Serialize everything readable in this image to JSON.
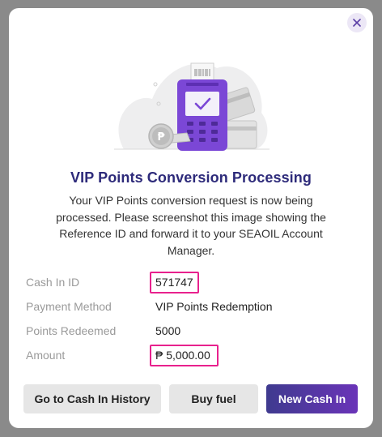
{
  "modal": {
    "close_icon": "close-icon",
    "title": "VIP Points Conversion Processing",
    "description": "Your VIP Points conversion request is now being processed. Please screenshot this image showing the Reference ID and forward it to your SEAOIL Account Manager.",
    "details": [
      {
        "label": "Cash In ID",
        "value": "571747",
        "highlighted": true
      },
      {
        "label": "Payment Method",
        "value": "VIP Points Redemption",
        "highlighted": false
      },
      {
        "label": "Points Redeemed",
        "value": "5000",
        "highlighted": false
      },
      {
        "label": "Amount",
        "value": "₱ 5,000.00",
        "highlighted": true
      }
    ],
    "buttons": {
      "history": "Go to Cash In History",
      "buy_fuel": "Buy fuel",
      "new_cash_in": "New Cash In"
    }
  },
  "colors": {
    "title": "#2d2a7a",
    "highlight": "#e8218d",
    "primary_start": "#3f3a8f",
    "primary_end": "#6a34b8",
    "terminal": "#7b47d6"
  }
}
